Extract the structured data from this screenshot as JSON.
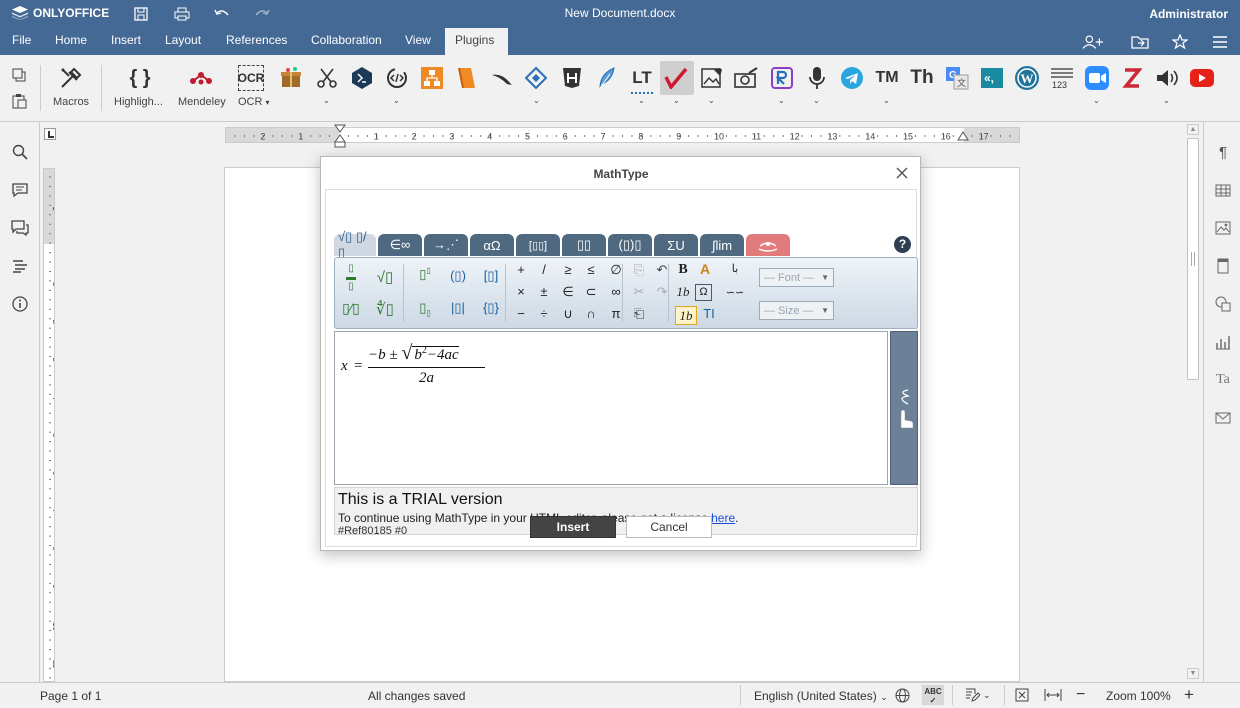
{
  "app": {
    "brand": "ONLYOFFICE",
    "document_title": "New Document.docx",
    "user": "Administrator",
    "accent_color": "#446995"
  },
  "menu": {
    "items": [
      "File",
      "Home",
      "Insert",
      "Layout",
      "References",
      "Collaboration",
      "View",
      "Plugins"
    ],
    "active": "Plugins"
  },
  "plugins": {
    "macros_label": "Macros",
    "highlight_label": "Highligh...",
    "mendeley_label": "Mendeley",
    "ocr_label": "OCR",
    "ocr_icon_text": "OCR",
    "lt_icon_text": "LT",
    "tm_icon_text": "TM",
    "th_icon_text": "Th",
    "icon_123_text": "123"
  },
  "ruler": {
    "h_ticks": [
      "2",
      "1",
      "1",
      "2",
      "3",
      "4",
      "5",
      "6",
      "7",
      "8",
      "9",
      "10",
      "11",
      "12",
      "13",
      "14",
      "15",
      "16",
      "17"
    ],
    "v_ticks": [
      "1",
      "1",
      "2",
      "3",
      "4",
      "5",
      "6",
      "7",
      "8",
      "9",
      "10",
      "11"
    ]
  },
  "dialog": {
    "title": "MathType",
    "help_icon": "?",
    "tabs": [
      "√▯ ▯/▯",
      "∈∞",
      "→⋰",
      "αΩ",
      "[▯▯]",
      "▯▯",
      "(▯)▯",
      "ΣU",
      "∫lim",
      "hand"
    ],
    "font_placeholder": "— Font —",
    "size_placeholder": "— Size —",
    "formula": {
      "lhs": "x",
      "eq": "=",
      "numerator": "−b ± √(b²−4ac)",
      "num_a": "−b ±",
      "num_root": "b",
      "num_exp": "2",
      "num_rest": "−4ac",
      "denominator": "2a"
    },
    "trial_title": "This is a TRIAL version",
    "trial_text": "To continue using MathType in your HTML editor, please get a license",
    "trial_link": "here",
    "trial_dot": ".",
    "trial_ref": "#Ref80185 #0",
    "insert_label": "Insert",
    "cancel_label": "Cancel"
  },
  "status": {
    "page": "Page 1 of 1",
    "saved": "All changes saved",
    "language": "English (United States)",
    "zoom": "Zoom 100%"
  }
}
